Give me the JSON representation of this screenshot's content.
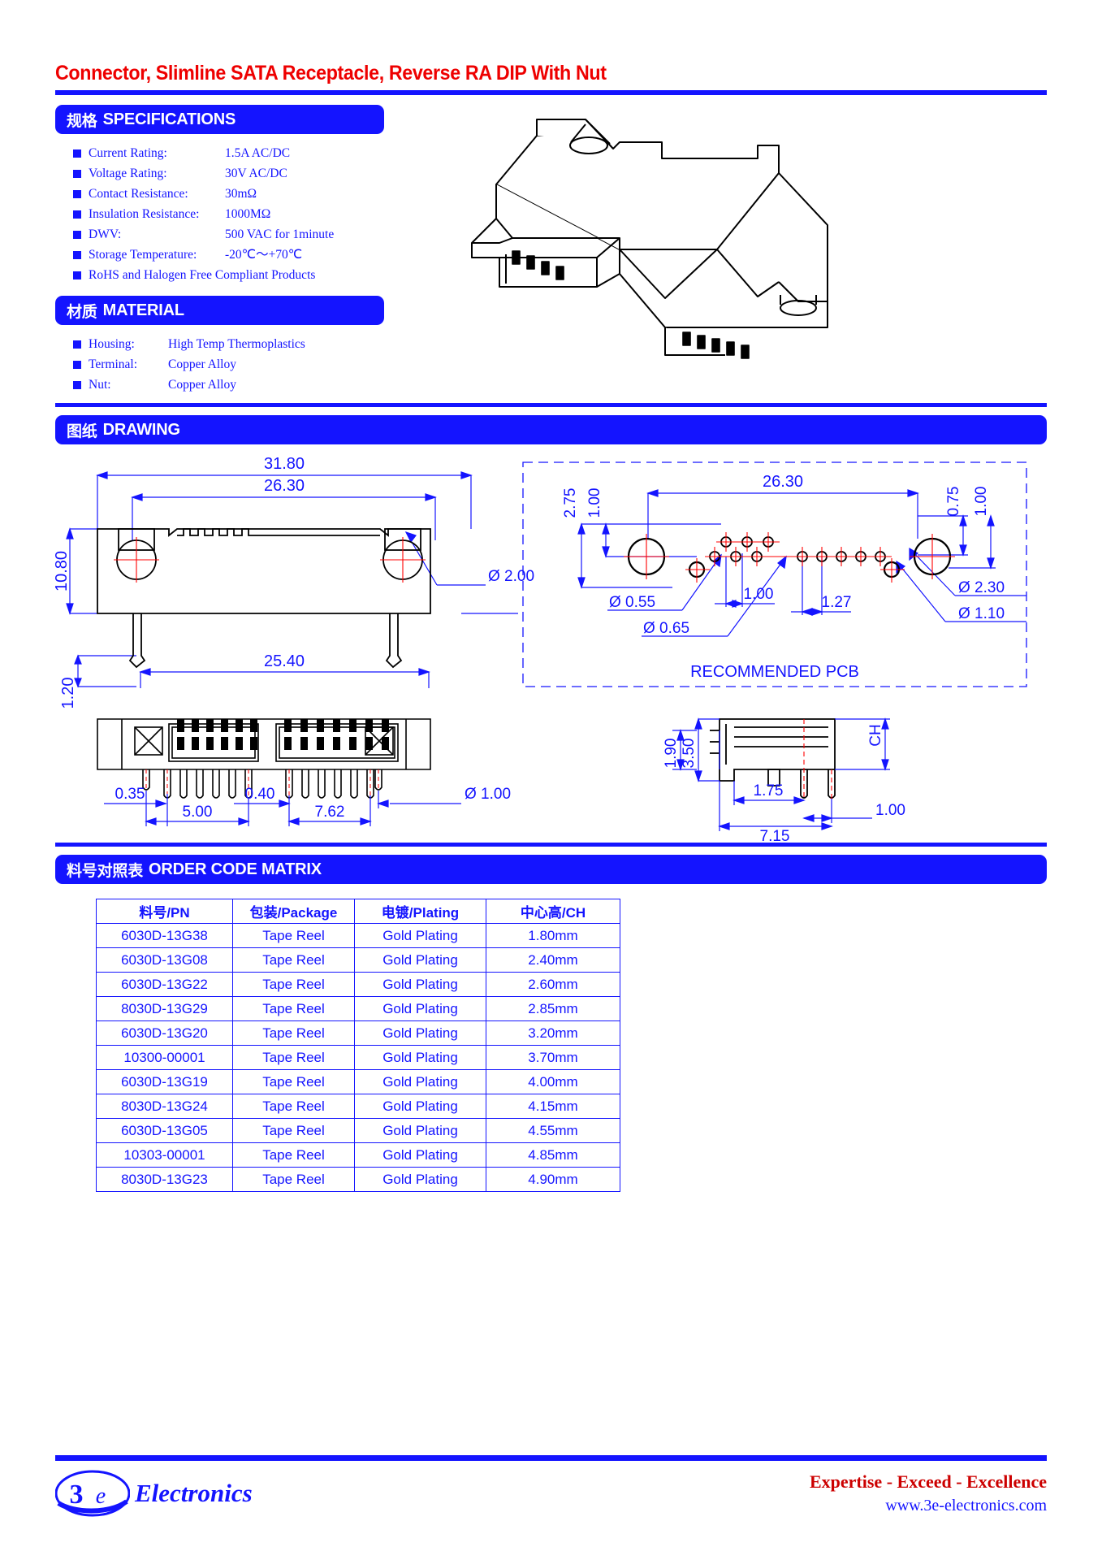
{
  "title": "Connector, Slimline SATA Receptacle, Reverse RA DIP With Nut",
  "colors": {
    "blue": "#1414ff",
    "red": "#ee0000",
    "dark_red": "#cc0000",
    "black": "#000000"
  },
  "specifications": {
    "header_cjk": "规格",
    "header_en": "SPECIFICATIONS",
    "items": [
      {
        "label": "Current Rating:",
        "value": "1.5A AC/DC"
      },
      {
        "label": "Voltage Rating:",
        "value": "30V AC/DC"
      },
      {
        "label": "Contact Resistance:",
        "value": "30mΩ"
      },
      {
        "label": "Insulation Resistance:",
        "value": "1000MΩ"
      },
      {
        "label": "DWV:",
        "value": "500 VAC for 1minute"
      },
      {
        "label": "Storage Temperature:",
        "value": "-20℃～+70℃"
      },
      {
        "label": "RoHS and Halogen Free Compliant Products",
        "value": ""
      }
    ]
  },
  "material": {
    "header_cjk": "材质",
    "header_en": "MATERIAL",
    "items": [
      {
        "label": "Housing:",
        "value": "High Temp Thermoplastics"
      },
      {
        "label": "Terminal:",
        "value": "Copper Alloy"
      },
      {
        "label": "Nut:",
        "value": "Copper Alloy"
      }
    ]
  },
  "drawing": {
    "header_cjk": "图纸",
    "header_en": "DRAWING",
    "pcb_note": "RECOMMENDED PCB",
    "front_view_dims": {
      "overall_width": "31.80",
      "mount_centers": "26.30",
      "height": "10.80",
      "pin_span": "25.40",
      "pin_protrusion": "1.20",
      "nut_hole_dia": "Ø 2.00"
    },
    "pcb_dims": {
      "edge_to_hole_v1": "2.75",
      "edge_to_hole_v2": "1.00",
      "hole_centers": "26.30",
      "right_v1": "0.75",
      "right_v2": "1.00",
      "pitch_a": "1.00",
      "pitch_b": "1.27",
      "dia_small": "Ø 0.55",
      "dia_medium": "Ø 0.65",
      "dia_large": "Ø 2.30",
      "dia_pin": "Ø 1.10"
    },
    "bottom_view_dims": {
      "a": "0.35",
      "b": "5.00",
      "c": "0.40",
      "d": "7.62",
      "pin_dia": "Ø 1.00"
    },
    "side_view_dims": {
      "ch": "CH",
      "h1": "3.50",
      "h2": "1.90",
      "w1": "1.75",
      "w2": "7.15",
      "w3": "1.00"
    }
  },
  "order_code_matrix": {
    "header_cjk": "料号对照表",
    "header_en": "ORDER CODE MATRIX",
    "columns": [
      "料号/PN",
      "包装/Package",
      "电镀/Plating",
      "中心高/CH"
    ],
    "rows": [
      [
        "6030D-13G38",
        "Tape Reel",
        "Gold Plating",
        "1.80mm"
      ],
      [
        "6030D-13G08",
        "Tape Reel",
        "Gold Plating",
        "2.40mm"
      ],
      [
        "6030D-13G22",
        "Tape Reel",
        "Gold Plating",
        "2.60mm"
      ],
      [
        "8030D-13G29",
        "Tape Reel",
        "Gold Plating",
        "2.85mm"
      ],
      [
        "6030D-13G20",
        "Tape Reel",
        "Gold Plating",
        "3.20mm"
      ],
      [
        "10300-00001",
        "Tape Reel",
        "Gold Plating",
        "3.70mm"
      ],
      [
        "6030D-13G19",
        "Tape Reel",
        "Gold Plating",
        "4.00mm"
      ],
      [
        "8030D-13G24",
        "Tape Reel",
        "Gold Plating",
        "4.15mm"
      ],
      [
        "6030D-13G05",
        "Tape Reel",
        "Gold Plating",
        "4.55mm"
      ],
      [
        "10303-00001",
        "Tape Reel",
        "Gold Plating",
        "4.85mm"
      ],
      [
        "8030D-13G23",
        "Tape Reel",
        "Gold Plating",
        "4.90mm"
      ]
    ]
  },
  "footer": {
    "brand_number": "3",
    "brand_e": "e",
    "brand_word": "Electronics",
    "tagline": "Expertise - Exceed - Excellence",
    "website": "www.3e-electronics.com"
  }
}
